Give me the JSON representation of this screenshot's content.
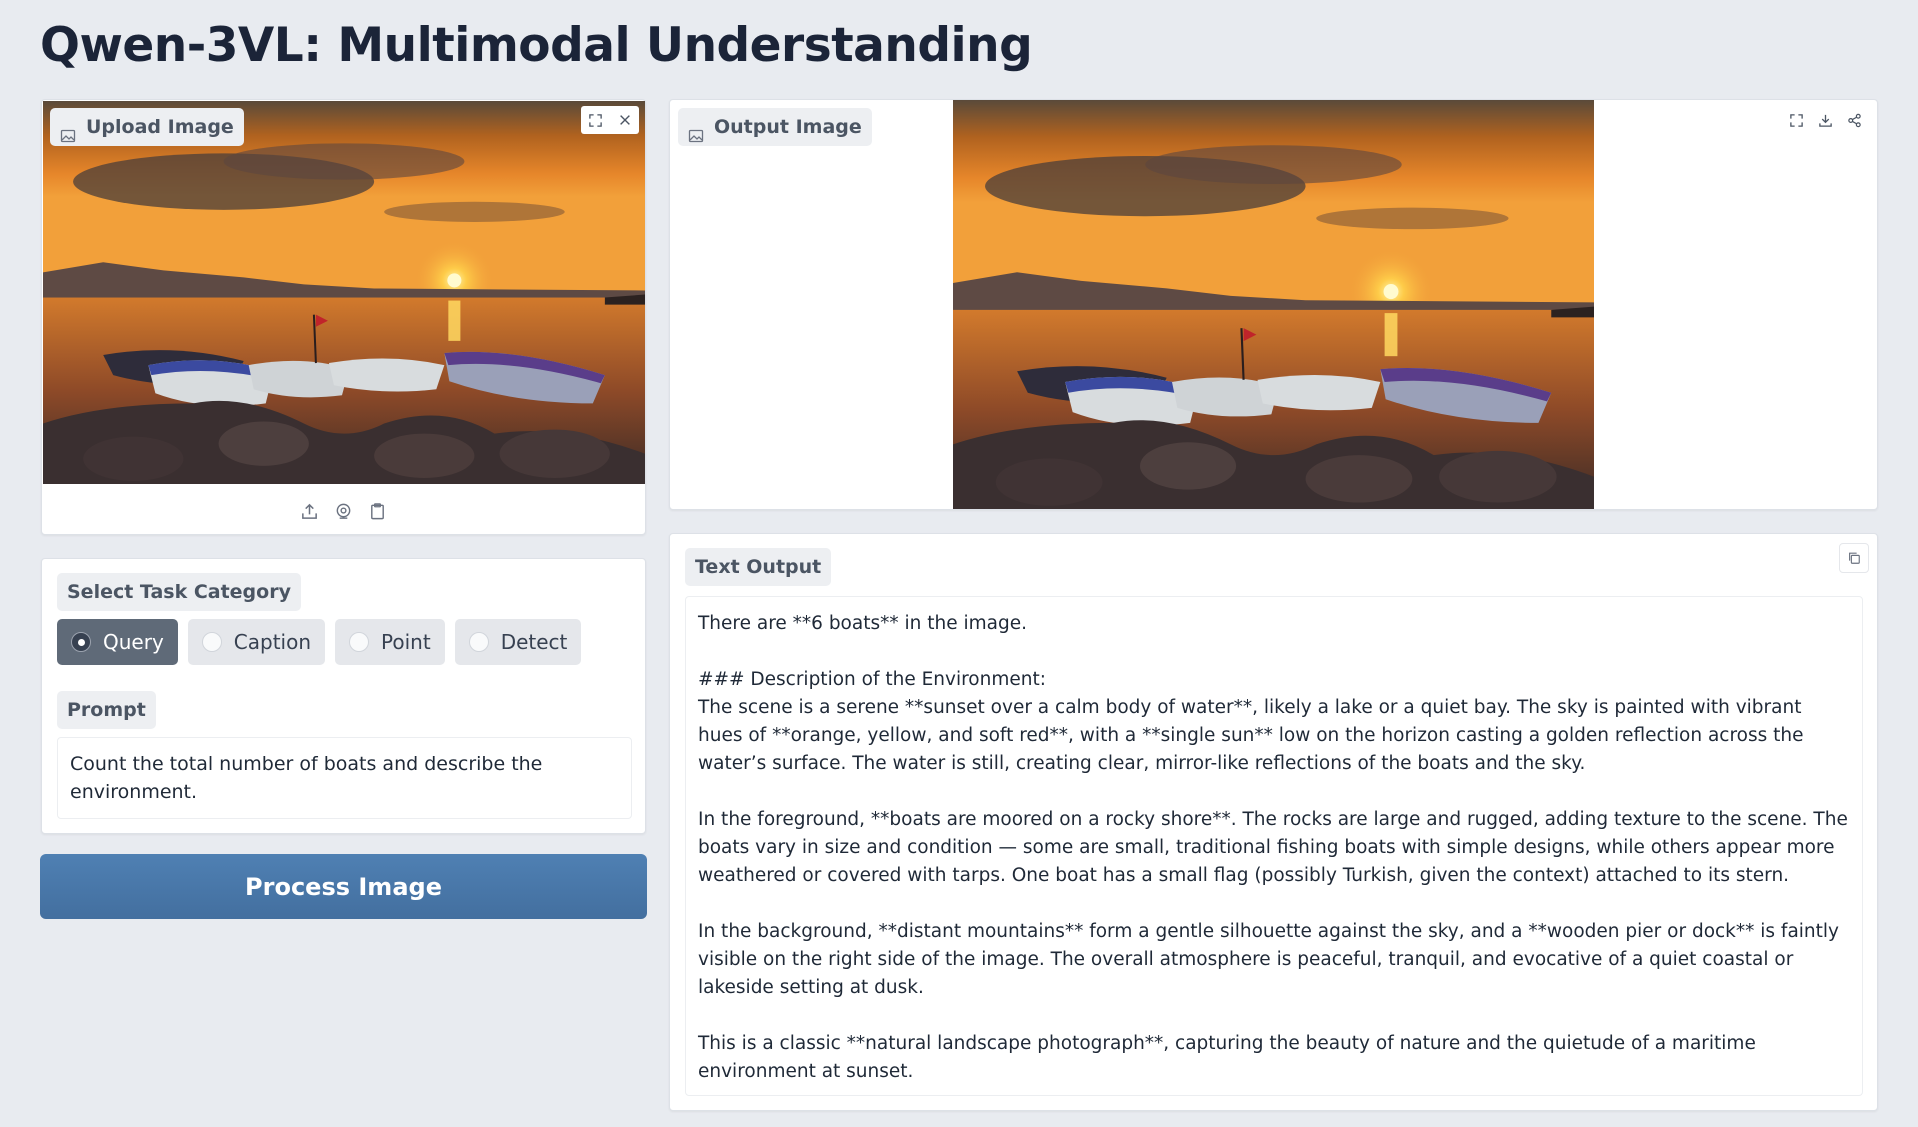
{
  "page_title": "Qwen-3VL: Multimodal Understanding",
  "upload": {
    "label": "Upload Image",
    "corner_icons": [
      "fullscreen-icon",
      "close-icon"
    ],
    "source_icons": [
      "upload-icon",
      "webcam-icon",
      "clipboard-icon"
    ]
  },
  "task": {
    "label": "Select Task Category",
    "options": [
      "Query",
      "Caption",
      "Point",
      "Detect"
    ],
    "selected": "Query"
  },
  "prompt": {
    "label": "Prompt",
    "value": "Count the total number of boats and describe the environment."
  },
  "process_button": "Process Image",
  "output_image": {
    "label": "Output Image",
    "corner_icons": [
      "fullscreen-icon",
      "download-icon",
      "share-icon"
    ]
  },
  "text_output": {
    "label": "Text Output",
    "value": "There are **6 boats** in the image.\n\n### Description of the Environment:\nThe scene is a serene **sunset over a calm body of water**, likely a lake or a quiet bay. The sky is painted with vibrant hues of **orange, yellow, and soft red**, with a **single sun** low on the horizon casting a golden reflection across the water’s surface. The water is still, creating clear, mirror-like reflections of the boats and the sky.\n\nIn the foreground, **boats are moored on a rocky shore**. The rocks are large and rugged, adding texture to the scene. The boats vary in size and condition — some are small, traditional fishing boats with simple designs, while others appear more weathered or covered with tarps. One boat has a small flag (possibly Turkish, given the context) attached to its stern.\n\nIn the background, **distant mountains** form a gentle silhouette against the sky, and a **wooden pier or dock** is faintly visible on the right side of the image. The overall atmosphere is peaceful, tranquil, and evocative of a quiet coastal or lakeside setting at dusk.\n\nThis is a classic **natural landscape photograph**, capturing the beauty of nature and the quietude of a maritime environment at sunset."
  },
  "colors": {
    "background": "#e8ebf0",
    "primary_button": "#4a7aad",
    "selected_radio": "#5f6a78"
  }
}
